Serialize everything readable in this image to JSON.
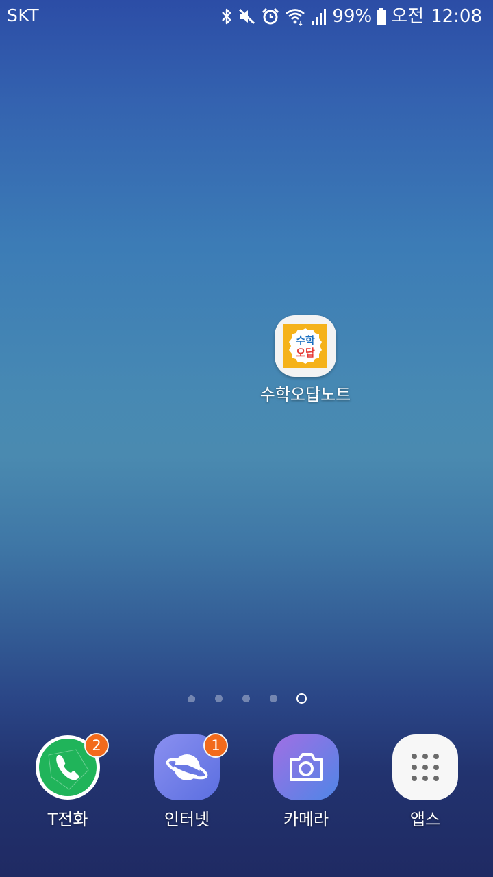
{
  "status_bar": {
    "carrier": "SKT",
    "battery_percent": "99%",
    "ampm": "오전",
    "time": "12:08",
    "icons": [
      "bluetooth-icon",
      "mute-icon",
      "alarm-icon",
      "wifi-icon",
      "signal-icon",
      "battery-icon"
    ]
  },
  "desktop": {
    "shortcut": {
      "label": "수학오답노트",
      "icon_text_top": "수학",
      "icon_text_bottom": "오답",
      "colors": {
        "frame": "#f5b21a",
        "top_text": "#1a6fc1",
        "bottom_text": "#e53935"
      }
    }
  },
  "page_indicator": {
    "count": 5,
    "active_index": 4
  },
  "dock": {
    "apps": [
      {
        "label": "T전화",
        "badge": "2",
        "icon": "phone-icon",
        "color": "#20b45a"
      },
      {
        "label": "인터넷",
        "badge": "1",
        "icon": "planet-icon",
        "color": "#6f7fe6"
      },
      {
        "label": "카메라",
        "badge": "",
        "icon": "camera-icon",
        "color": "#8a6fe6"
      },
      {
        "label": "앱스",
        "badge": "",
        "icon": "apps-grid-icon",
        "color": "#f7f7f7"
      }
    ]
  }
}
